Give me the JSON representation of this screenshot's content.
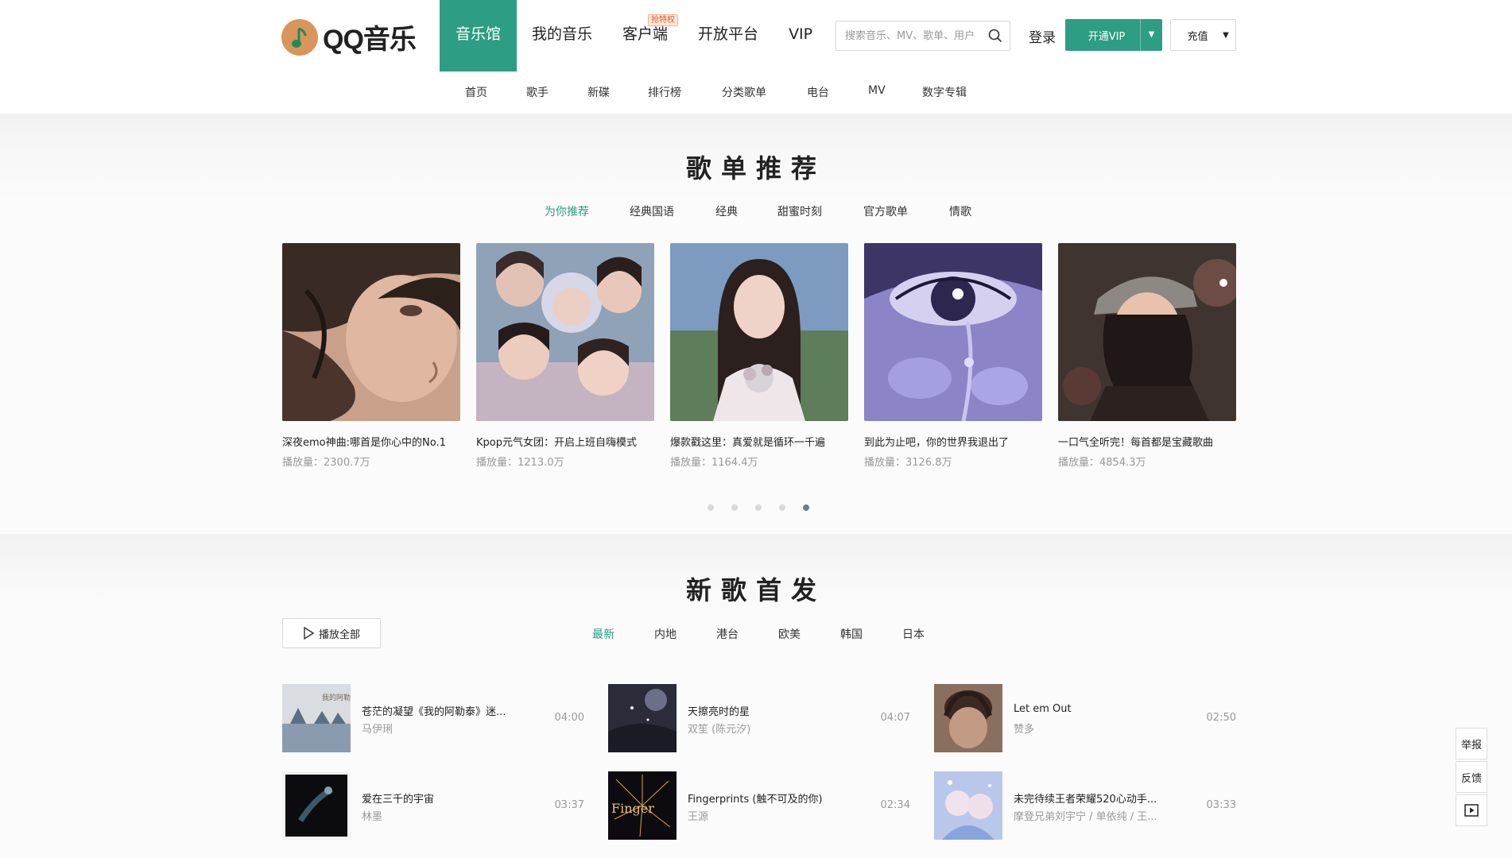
{
  "header": {
    "logo_text": "QQ音乐",
    "nav": [
      {
        "label": "音乐馆",
        "active": true
      },
      {
        "label": "我的音乐"
      },
      {
        "label": "客户端",
        "badge": "抢特权"
      },
      {
        "label": "开放平台"
      },
      {
        "label": "VIP"
      }
    ],
    "search_placeholder": "搜索音乐、MV、歌单、用户",
    "login": "登录",
    "vip_button": "开通VIP",
    "charge_button": "充值"
  },
  "subnav": [
    "首页",
    "歌手",
    "新碟",
    "排行榜",
    "分类歌单",
    "电台",
    "MV",
    "数字专辑"
  ],
  "playlist_section": {
    "title": "歌单推荐",
    "tabs": [
      "为你推荐",
      "经典国语",
      "经典",
      "甜蜜时刻",
      "官方歌单",
      "情歌"
    ],
    "active_tab": 0,
    "items": [
      {
        "title": "深夜emo神曲:哪首是你心中的No.1",
        "plays": "播放量：2300.7万"
      },
      {
        "title": "Kpop元气女团：开启上班自嗨模式",
        "plays": "播放量：1213.0万"
      },
      {
        "title": "爆款戳这里：真爱就是循环一千遍",
        "plays": "播放量：1164.4万"
      },
      {
        "title": "到此为止吧，你的世界我退出了",
        "plays": "播放量：3126.8万"
      },
      {
        "title": "一口气全听完！每首都是宝藏歌曲",
        "plays": "播放量：4854.3万"
      }
    ],
    "pages": 5,
    "active_page": 4
  },
  "new_songs": {
    "title": "新歌首发",
    "play_all": "播放全部",
    "tabs": [
      "最新",
      "内地",
      "港台",
      "欧美",
      "韩国",
      "日本"
    ],
    "active_tab": 0,
    "songs": [
      {
        "name": "苍茫的凝望《我的阿勒泰》迷...",
        "artist": "马伊琍",
        "duration": "04:00"
      },
      {
        "name": "天擦亮时的星",
        "artist": "双笙 (陈元汐)",
        "duration": "04:07"
      },
      {
        "name": "Let em Out",
        "artist": "赞多",
        "duration": "02:50"
      },
      {
        "name": "爱在三千的宇宙",
        "artist": "林墨",
        "duration": "03:37"
      },
      {
        "name": "Fingerprints (触不可及的你)",
        "artist": "王源",
        "duration": "02:34"
      },
      {
        "name": "未完待续王者荣耀520心动手...",
        "artist": "摩登兄弟刘宇宁 / 单依纯 / 王...",
        "duration": "03:33"
      }
    ]
  },
  "side": {
    "report": "举报",
    "feedback": "反馈"
  },
  "colors": {
    "accent": "#2d9d83",
    "muted": "#999999"
  }
}
